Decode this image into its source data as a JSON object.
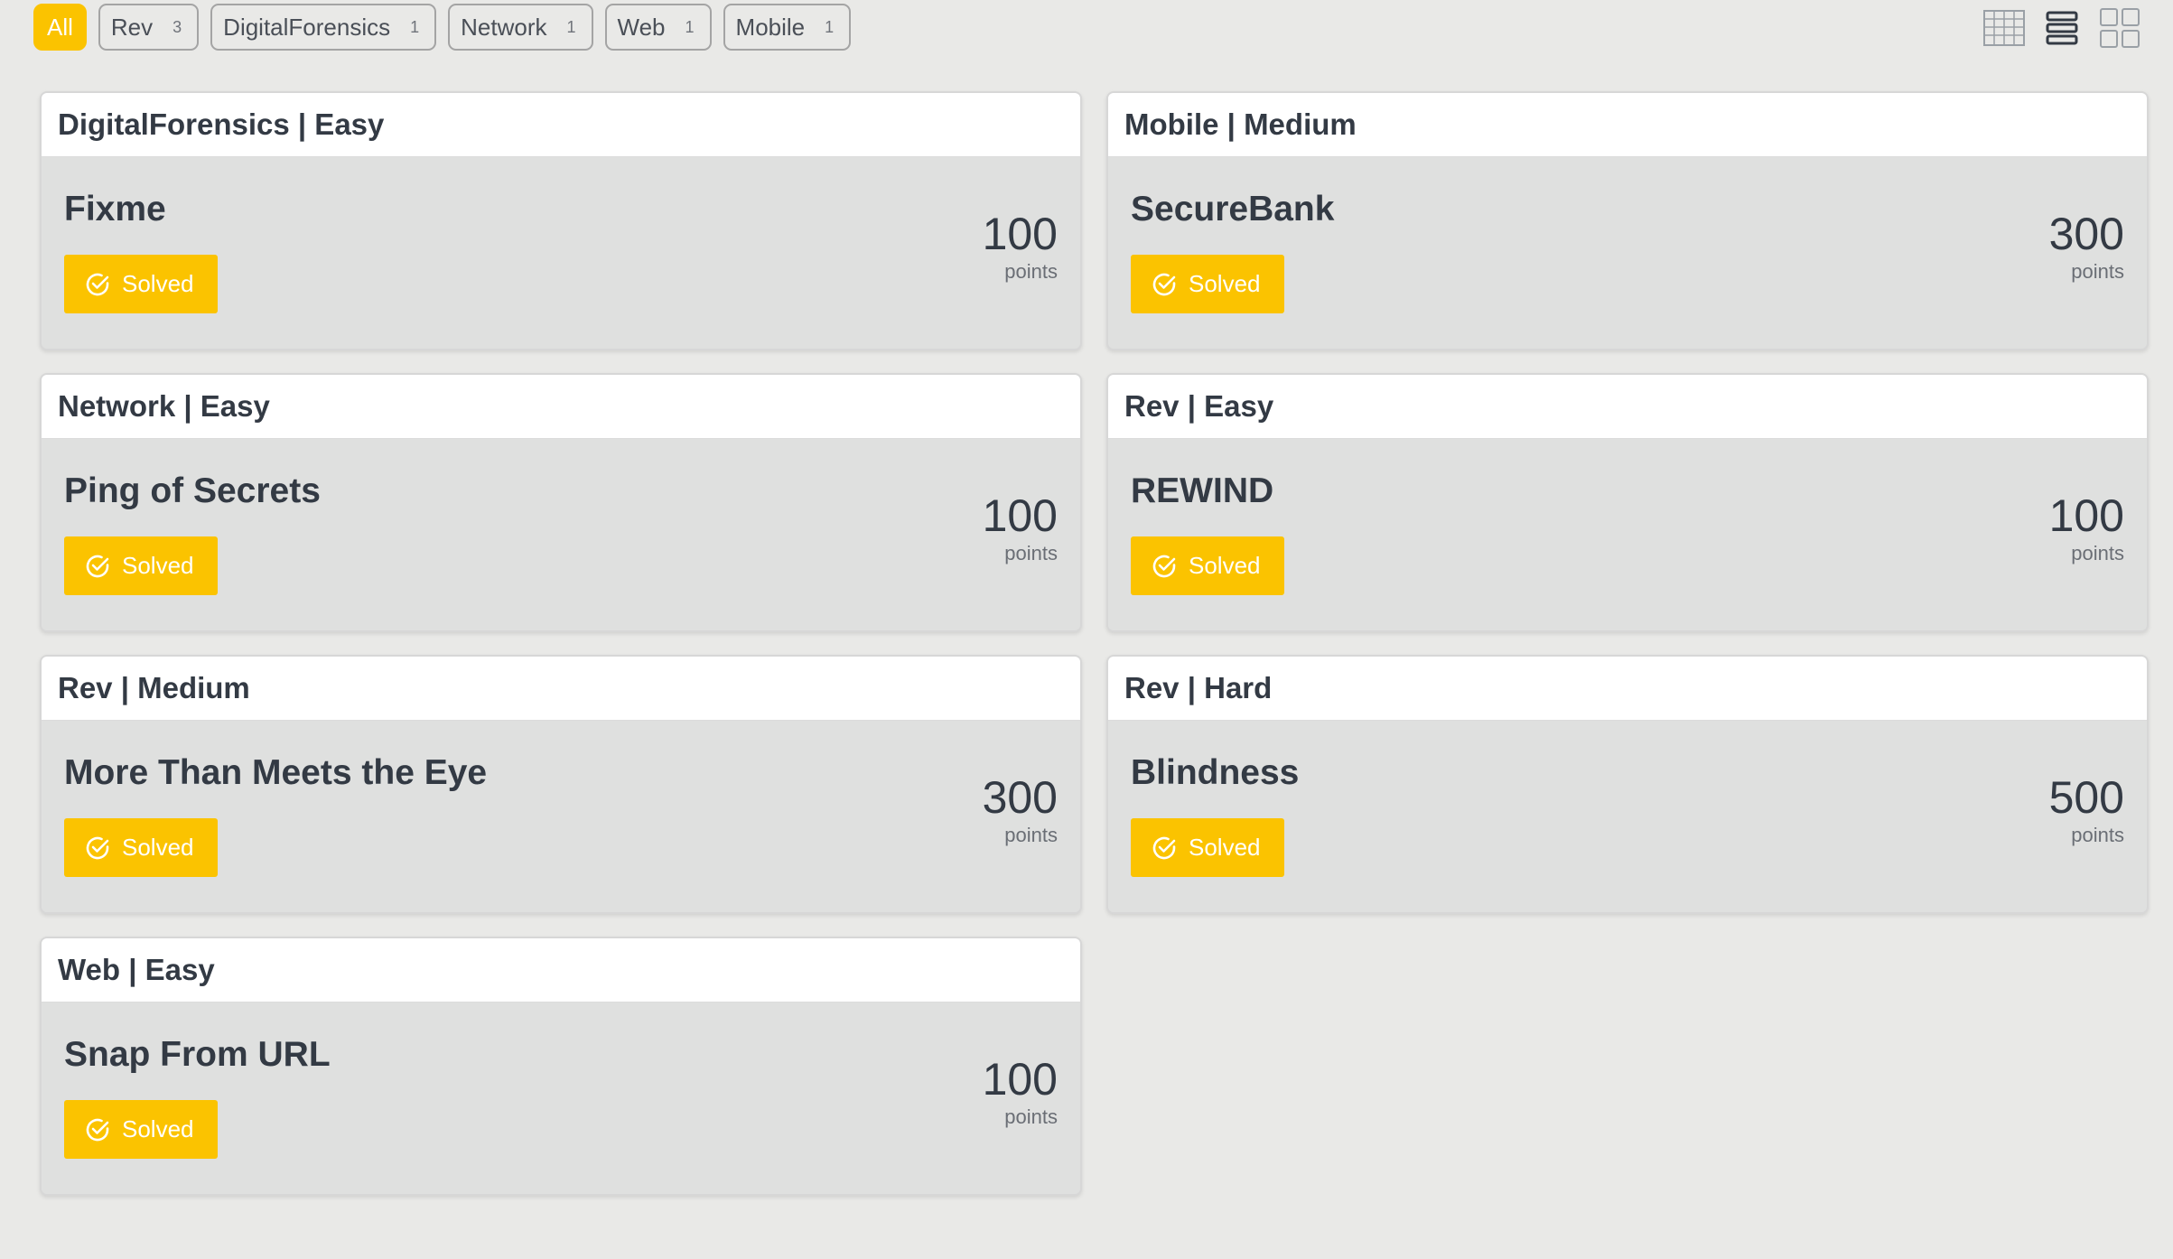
{
  "filters": [
    {
      "label": "All",
      "count": null,
      "active": true
    },
    {
      "label": "Rev",
      "count": "3"
    },
    {
      "label": "DigitalForensics",
      "count": "1"
    },
    {
      "label": "Network",
      "count": "1"
    },
    {
      "label": "Web",
      "count": "1"
    },
    {
      "label": "Mobile",
      "count": "1"
    }
  ],
  "view_toggles": [
    "table-view-icon",
    "list-view-icon",
    "grid-view-icon"
  ],
  "colors": {
    "accent": "#fbc300",
    "background": "#e9e9e7",
    "card_body": "#dfe0df",
    "text": "#333a44"
  },
  "challenges": [
    {
      "header": "DigitalForensics | Easy",
      "title": "Fixme",
      "status": "Solved",
      "points": "100",
      "points_label": "points"
    },
    {
      "header": "Mobile | Medium",
      "title": "SecureBank",
      "status": "Solved",
      "points": "300",
      "points_label": "points"
    },
    {
      "header": "Network | Easy",
      "title": "Ping of Secrets",
      "status": "Solved",
      "points": "100",
      "points_label": "points"
    },
    {
      "header": "Rev | Easy",
      "title": "REWIND",
      "status": "Solved",
      "points": "100",
      "points_label": "points"
    },
    {
      "header": "Rev | Medium",
      "title": "More Than Meets the Eye",
      "status": "Solved",
      "points": "300",
      "points_label": "points"
    },
    {
      "header": "Rev | Hard",
      "title": "Blindness",
      "status": "Solved",
      "points": "500",
      "points_label": "points"
    },
    {
      "header": "Web | Easy",
      "title": "Snap From URL",
      "status": "Solved",
      "points": "100",
      "points_label": "points"
    }
  ]
}
